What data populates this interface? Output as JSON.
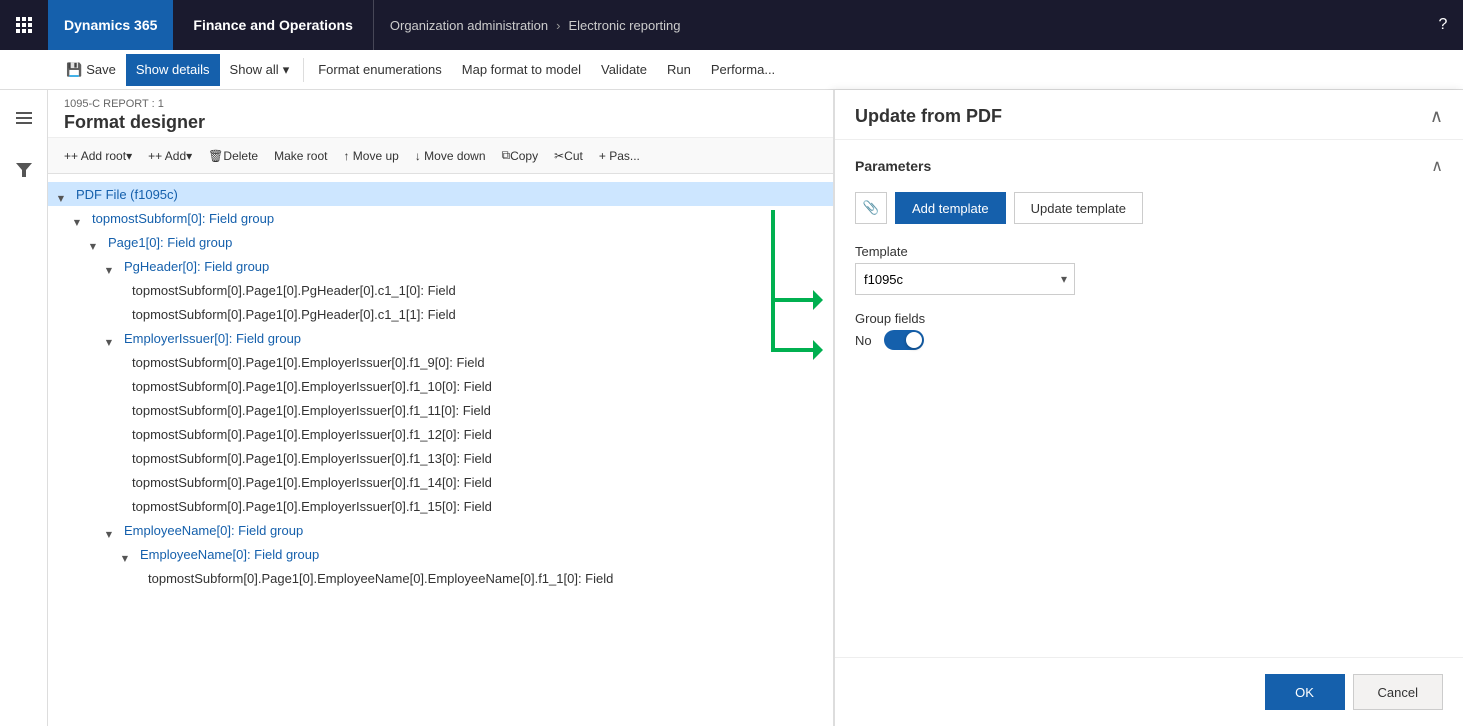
{
  "topNav": {
    "appsLabel": "Apps",
    "brand1": "Dynamics 365",
    "brand2": "Finance and Operations",
    "breadcrumb1": "Organization administration",
    "breadcrumb2": "Electronic reporting",
    "helpLabel": "?"
  },
  "toolbar": {
    "saveLabel": "Save",
    "showDetailsLabel": "Show details",
    "showAllLabel": "Show all",
    "showAllDropdown": true,
    "formatEnumerationsLabel": "Format enumerations",
    "mapFormatToModelLabel": "Map format to model",
    "validateLabel": "Validate",
    "runLabel": "Run",
    "performanceLabel": "Performa..."
  },
  "contentHeader": {
    "breadcrumb": "1095-C REPORT : 1",
    "title": "Format designer"
  },
  "designerToolbar": {
    "addRootLabel": "+ Add root",
    "addLabel": "+ Add",
    "deleteLabel": "Delete",
    "makeRootLabel": "Make root",
    "moveUpLabel": "↑ Move up",
    "moveDownLabel": "↓ Move down",
    "copyLabel": "Copy",
    "cutLabel": "Cut",
    "pasteLabel": "+ Pas..."
  },
  "tree": [
    {
      "id": "pdf-file",
      "label": "PDF File (f1095c)",
      "indent": 0,
      "hasArrow": true,
      "highlighted": true,
      "isField": false
    },
    {
      "id": "topmost-subform",
      "label": "topmostSubform[0]: Field group",
      "indent": 1,
      "hasArrow": true,
      "highlighted": false,
      "isField": false
    },
    {
      "id": "page1",
      "label": "Page1[0]: Field group",
      "indent": 2,
      "hasArrow": true,
      "highlighted": false,
      "isField": false
    },
    {
      "id": "pgheader",
      "label": "PgHeader[0]: Field group",
      "indent": 3,
      "hasArrow": true,
      "highlighted": false,
      "isField": false
    },
    {
      "id": "c1-1-0",
      "label": "topmostSubform[0].Page1[0].PgHeader[0].c1_1[0]: Field",
      "indent": 4,
      "hasArrow": false,
      "highlighted": false,
      "isField": true
    },
    {
      "id": "c1-1-1",
      "label": "topmostSubform[0].Page1[0].PgHeader[0].c1_1[1]: Field",
      "indent": 4,
      "hasArrow": false,
      "highlighted": false,
      "isField": true
    },
    {
      "id": "employer-issuer",
      "label": "EmployerIssuer[0]: Field group",
      "indent": 3,
      "hasArrow": true,
      "highlighted": false,
      "isField": false
    },
    {
      "id": "f1-9",
      "label": "topmostSubform[0].Page1[0].EmployerIssuer[0].f1_9[0]: Field",
      "indent": 4,
      "hasArrow": false,
      "highlighted": false,
      "isField": true
    },
    {
      "id": "f1-10",
      "label": "topmostSubform[0].Page1[0].EmployerIssuer[0].f1_10[0]: Field",
      "indent": 4,
      "hasArrow": false,
      "highlighted": false,
      "isField": true
    },
    {
      "id": "f1-11",
      "label": "topmostSubform[0].Page1[0].EmployerIssuer[0].f1_11[0]: Field",
      "indent": 4,
      "hasArrow": false,
      "highlighted": false,
      "isField": true
    },
    {
      "id": "f1-12",
      "label": "topmostSubform[0].Page1[0].EmployerIssuer[0].f1_12[0]: Field",
      "indent": 4,
      "hasArrow": false,
      "highlighted": false,
      "isField": true
    },
    {
      "id": "f1-13",
      "label": "topmostSubform[0].Page1[0].EmployerIssuer[0].f1_13[0]: Field",
      "indent": 4,
      "hasArrow": false,
      "highlighted": false,
      "isField": true
    },
    {
      "id": "f1-14",
      "label": "topmostSubform[0].Page1[0].EmployerIssuer[0].f1_14[0]: Field",
      "indent": 4,
      "hasArrow": false,
      "highlighted": false,
      "isField": true
    },
    {
      "id": "f1-15",
      "label": "topmostSubform[0].Page1[0].EmployerIssuer[0].f1_15[0]: Field",
      "indent": 4,
      "hasArrow": false,
      "highlighted": false,
      "isField": true
    },
    {
      "id": "employee-name-group",
      "label": "EmployeeName[0]: Field group",
      "indent": 3,
      "hasArrow": true,
      "highlighted": false,
      "isField": false
    },
    {
      "id": "employee-name-nested",
      "label": "EmployeeName[0]: Field group",
      "indent": 4,
      "hasArrow": true,
      "highlighted": false,
      "isField": false
    },
    {
      "id": "employee-name-field",
      "label": "topmostSubform[0].Page1[0].EmployeeName[0].EmployeeName[0].f1_1[0]: Field",
      "indent": 5,
      "hasArrow": false,
      "highlighted": false,
      "isField": true
    }
  ],
  "rightPanel": {
    "title": "Update from PDF",
    "parametersLabel": "Parameters",
    "attachmentIconLabel": "📎",
    "addTemplateLabel": "Add template",
    "updateTemplateLabel": "Update template",
    "templateLabel": "Template",
    "templateValue": "f1095c",
    "templateOptions": [
      "f1095c"
    ],
    "groupFieldsLabel": "Group fields",
    "groupFieldsToggle": "No",
    "toggleOn": false,
    "okLabel": "OK",
    "cancelLabel": "Cancel"
  },
  "colors": {
    "primary": "#1560ac",
    "activeBg": "#1560ac",
    "highlightBg": "#cde6ff",
    "green": "#00b050"
  }
}
